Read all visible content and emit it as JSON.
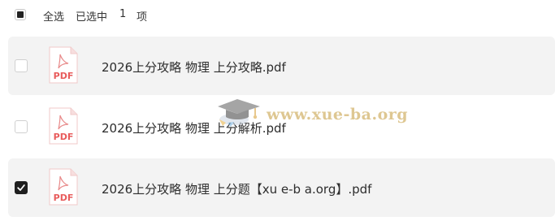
{
  "toolbar": {
    "select_all_label": "全选",
    "selected_prefix": "已选中",
    "selected_count": "1",
    "selected_unit": "项"
  },
  "files": [
    {
      "name": "2026上分攻略 物理 上分攻略.pdf",
      "checked": false,
      "icon": "pdf-file-icon",
      "icon_label": "PDF"
    },
    {
      "name": "2026上分攻略 物理 上分解析.pdf",
      "checked": false,
      "icon": "pdf-file-icon",
      "icon_label": "PDF"
    },
    {
      "name": "2026上分攻略 物理 上分题【xu e-b a.org】.pdf",
      "checked": true,
      "icon": "pdf-file-icon",
      "icon_label": "PDF"
    }
  ],
  "watermark": {
    "text": "www.xue-ba.org",
    "icon": "graduation-cap-icon"
  },
  "colors": {
    "pdf_red": "#e85b5b",
    "row_bg": "#f3f3f3",
    "check_bg": "#1f1f1f",
    "watermark": "#c9a24a"
  }
}
